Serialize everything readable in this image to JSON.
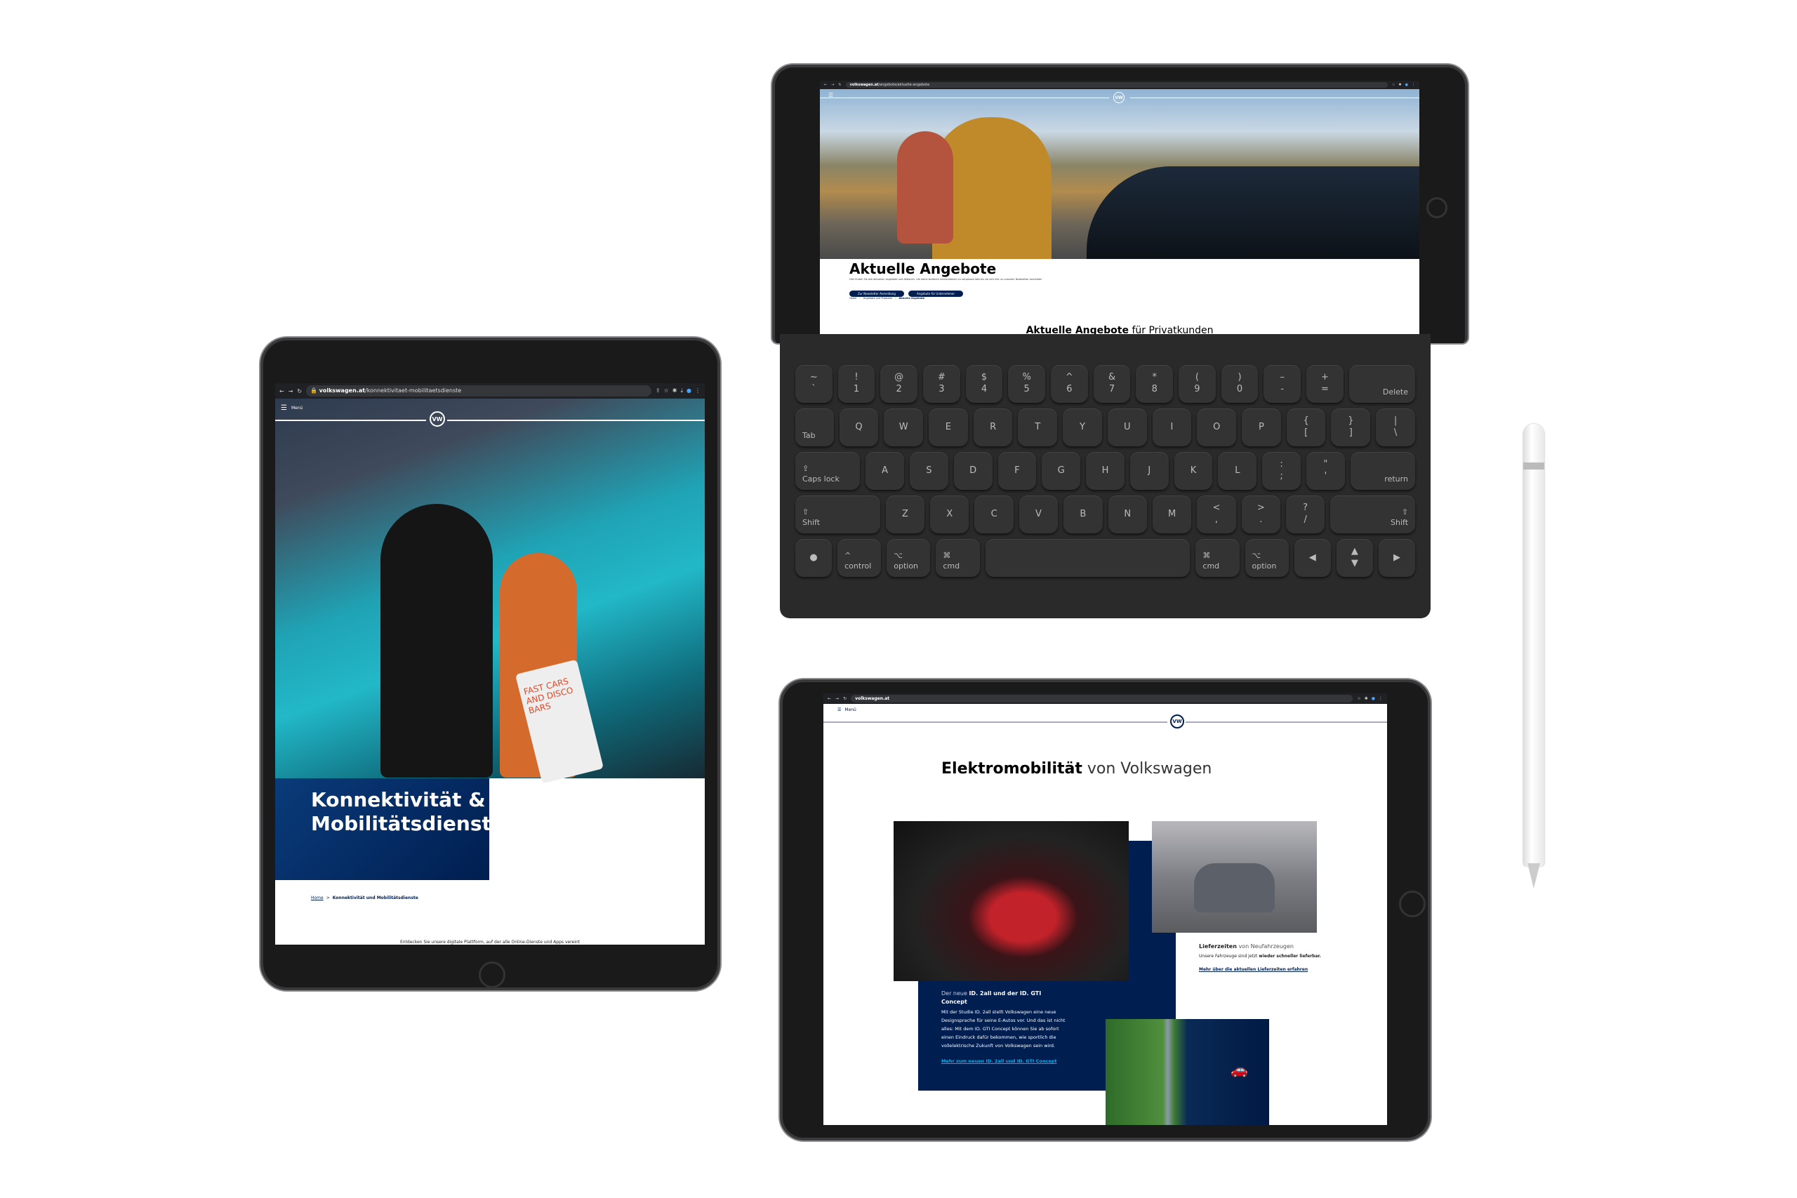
{
  "left_ipad": {
    "url_domain": "volkswagen.at",
    "url_path": "/konnektivitaet-mobilitaetsdienste",
    "menu_label": "Menü",
    "logo": "VW",
    "hero_title_line1": "Konnektivität &",
    "hero_title_line2": "Mobilitätsdienste",
    "breadcrumb": {
      "home": "Home",
      "separator": ">",
      "current": "Konnektivität und Mobilitätsdienste"
    },
    "intro_text": "Entdecken Sie unsere digitale Plattform, auf der alle Online-Dienste und Apps vereint",
    "hero_bag_text": "FAST CARS AND DISCO BARS"
  },
  "top_ipad": {
    "url_domain": "volkswagen.at",
    "url_path": "/angebote/aktuelle-angebote",
    "logo": "VW",
    "title": "Aktuelle Angebote",
    "subtitle": "Hier finden Sie alle aktuellen Angebote und Aktionen. Um keine weiteren Informationen zu verpassen können sie sich hier zu unserem Newsletter anmelden",
    "buttons": [
      "Zur Newsletter Anmeldung",
      "Angebote für Unternehmer"
    ],
    "breadcrumb": [
      "Home",
      "Angebote und Produkte",
      "Aktuelle Angebote"
    ],
    "section_title_bold": "Aktuelle Angebote",
    "section_title_light": "für Privatkunden"
  },
  "keyboard": {
    "rows": [
      [
        {
          "t": "~",
          "b": "`"
        },
        {
          "t": "!",
          "b": "1"
        },
        {
          "t": "@",
          "b": "2"
        },
        {
          "t": "#",
          "b": "3"
        },
        {
          "t": "$",
          "b": "4"
        },
        {
          "t": "%",
          "b": "5"
        },
        {
          "t": "^",
          "b": "6"
        },
        {
          "t": "&",
          "b": "7"
        },
        {
          "t": "*",
          "b": "8"
        },
        {
          "t": "(",
          "b": "9"
        },
        {
          "t": ")",
          "b": "0"
        },
        {
          "t": "–",
          "b": "-"
        },
        {
          "t": "+",
          "b": "="
        },
        {
          "t": "",
          "b": "Delete"
        }
      ],
      [
        {
          "t": "",
          "b": "Tab"
        },
        {
          "t": "",
          "b": "Q"
        },
        {
          "t": "",
          "b": "W"
        },
        {
          "t": "",
          "b": "E"
        },
        {
          "t": "",
          "b": "R"
        },
        {
          "t": "",
          "b": "T"
        },
        {
          "t": "",
          "b": "Y"
        },
        {
          "t": "",
          "b": "U"
        },
        {
          "t": "",
          "b": "I"
        },
        {
          "t": "",
          "b": "O"
        },
        {
          "t": "",
          "b": "P"
        },
        {
          "t": "{",
          "b": "["
        },
        {
          "t": "}",
          "b": "]"
        },
        {
          "t": "|",
          "b": "\\"
        }
      ],
      [
        {
          "t": "⇪",
          "b": "Caps lock"
        },
        {
          "t": "",
          "b": "A"
        },
        {
          "t": "",
          "b": "S"
        },
        {
          "t": "",
          "b": "D"
        },
        {
          "t": "",
          "b": "F"
        },
        {
          "t": "",
          "b": "G"
        },
        {
          "t": "",
          "b": "H"
        },
        {
          "t": "",
          "b": "J"
        },
        {
          "t": "",
          "b": "K"
        },
        {
          "t": "",
          "b": "L"
        },
        {
          "t": ":",
          "b": ";"
        },
        {
          "t": "\"",
          "b": "'"
        },
        {
          "t": "",
          "b": "return"
        }
      ],
      [
        {
          "t": "⇧",
          "b": "Shift"
        },
        {
          "t": "",
          "b": "Z"
        },
        {
          "t": "",
          "b": "X"
        },
        {
          "t": "",
          "b": "C"
        },
        {
          "t": "",
          "b": "V"
        },
        {
          "t": "",
          "b": "B"
        },
        {
          "t": "",
          "b": "N"
        },
        {
          "t": "",
          "b": "M"
        },
        {
          "t": "<",
          "b": ","
        },
        {
          "t": ">",
          "b": "."
        },
        {
          "t": "?",
          "b": "/"
        },
        {
          "t": "⇧",
          "b": "Shift"
        }
      ],
      [
        {
          "t": "●",
          "b": ""
        },
        {
          "t": "^",
          "b": "control"
        },
        {
          "t": "⌥",
          "b": "option"
        },
        {
          "t": "⌘",
          "b": "cmd"
        },
        {
          "t": "",
          "b": ""
        },
        {
          "t": "⌘",
          "b": "cmd"
        },
        {
          "t": "⌥",
          "b": "option"
        },
        {
          "t": "◀",
          "b": ""
        },
        {
          "t": "▲",
          "b": "▼"
        },
        {
          "t": "▶",
          "b": ""
        }
      ]
    ]
  },
  "bottom_ipad": {
    "url_domain": "volkswagen.at",
    "menu_label": "Menü",
    "logo": "VW",
    "title_bold": "Elektromobilität",
    "title_light": "von Volkswagen",
    "id_card": {
      "heading_light": "Der neue",
      "heading_bold": "ID. 2all und der ID. GTI Concept",
      "body": "Mit der Studie ID. 2all stellt Volkswagen eine neue Designsprache für seine E-Autos vor. Und das ist nicht alles: Mit dem ID. GTI Concept können Sie ab sofort einen Eindruck dafür bekommen, wie sportlich die vollelektrische Zukunft von Volkswagen sein wird.",
      "link": "Mehr zum neuen ID. 2all und ID. GTI Concept"
    },
    "delivery_card": {
      "heading_bold": "Lieferzeiten",
      "heading_light": "von Neufahrzeugen",
      "body_light": "Unsere Fahrzeuge sind jetzt",
      "body_bold": "wieder schneller lieferbar.",
      "link": "Mehr über die aktuellen Lieferzeiten erfahren"
    }
  },
  "colors": {
    "vw_navy": "#001e50",
    "link_cyan": "#00b0f0",
    "device": "#1a1a1a",
    "keyboard": "#2a2a2b"
  }
}
